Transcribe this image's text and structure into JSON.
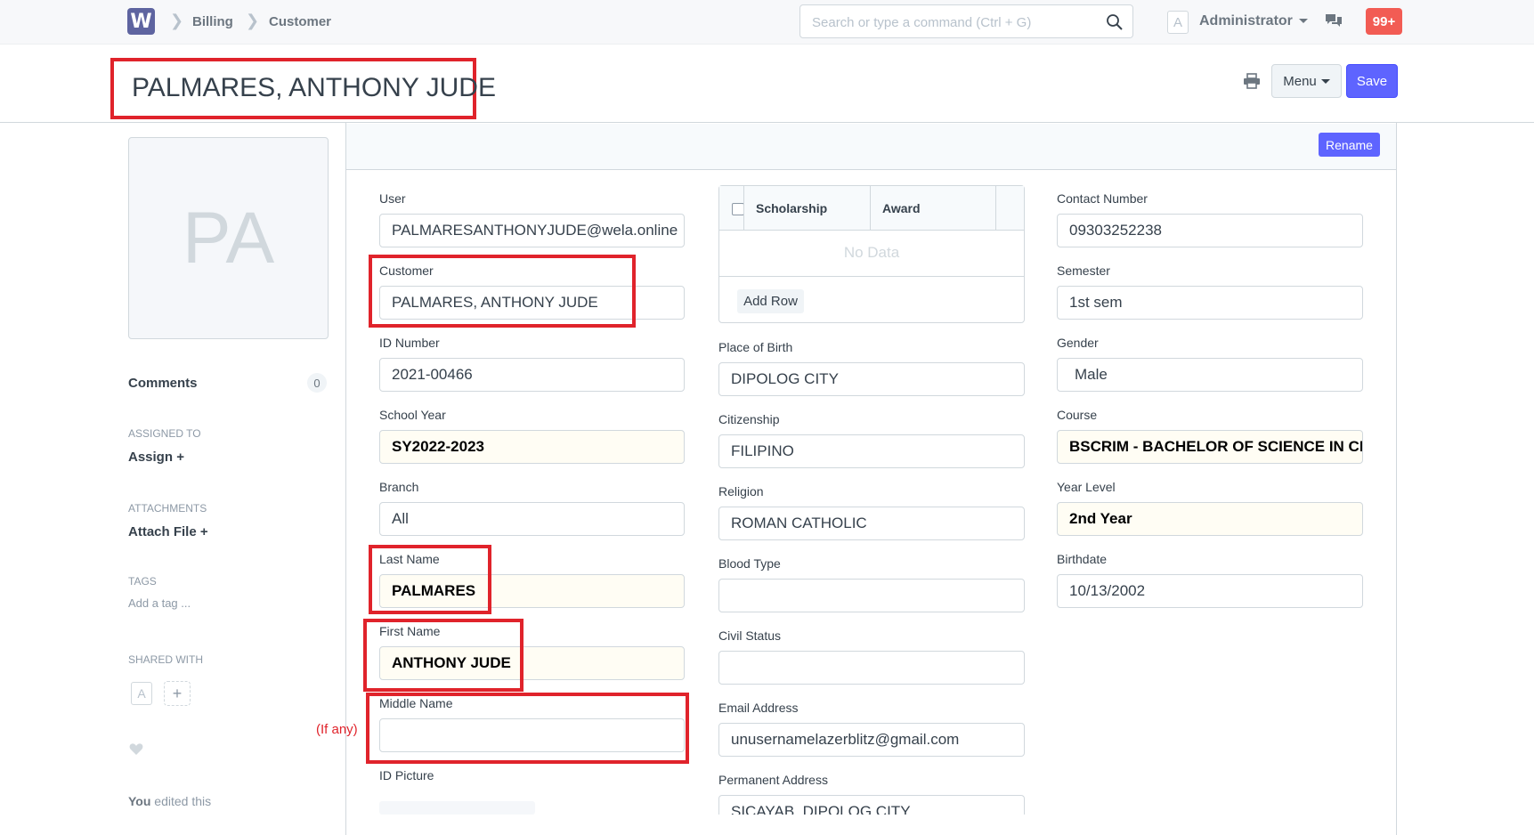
{
  "navbar": {
    "logo": "W",
    "breadcrumbs": [
      "Billing",
      "Customer"
    ],
    "search_placeholder": "Search or type a command (Ctrl + G)",
    "user_initial": "A",
    "user_name": "Administrator",
    "notification_count": "99+"
  },
  "page": {
    "title": "PALMARES, ANTHONY JUDE",
    "menu_label": "Menu",
    "save_label": "Save",
    "rename_label": "Rename"
  },
  "sidebar": {
    "avatar_initials": "PA",
    "comments_label": "Comments",
    "comments_count": "0",
    "assigned_to_label": "ASSIGNED TO",
    "assign_label": "Assign",
    "attachments_label": "ATTACHMENTS",
    "attach_file_label": "Attach File",
    "tags_label": "TAGS",
    "add_tag_label": "Add a tag ...",
    "shared_with_label": "SHARED WITH",
    "shared_initial": "A",
    "edited_by": "You",
    "edited_text": "edited this"
  },
  "form": {
    "user": {
      "label": "User",
      "value": "PALMARESANTHONYJUDE@wela.online"
    },
    "customer": {
      "label": "Customer",
      "value": "PALMARES, ANTHONY JUDE"
    },
    "id_number": {
      "label": "ID Number",
      "value": "2021-00466"
    },
    "school_year": {
      "label": "School Year",
      "value": "SY2022-2023"
    },
    "branch": {
      "label": "Branch",
      "value": "All"
    },
    "last_name": {
      "label": "Last Name",
      "value": "PALMARES"
    },
    "first_name": {
      "label": "First Name",
      "value": "ANTHONY JUDE"
    },
    "middle_name": {
      "label": "Middle Name",
      "value": "",
      "note": "(If any)"
    },
    "id_picture": {
      "label": "ID Picture"
    },
    "scholarship_table": {
      "columns": [
        "Scholarship",
        "Award"
      ],
      "empty_text": "No Data",
      "add_row_label": "Add Row"
    },
    "place_of_birth": {
      "label": "Place of Birth",
      "value": "DIPOLOG CITY"
    },
    "citizenship": {
      "label": "Citizenship",
      "value": "FILIPINO"
    },
    "religion": {
      "label": "Religion",
      "value": "ROMAN CATHOLIC"
    },
    "blood_type": {
      "label": "Blood Type",
      "value": ""
    },
    "civil_status": {
      "label": "Civil Status",
      "value": ""
    },
    "email_address": {
      "label": "Email Address",
      "value": "unusernamelazerblitz@gmail.com"
    },
    "permanent_address": {
      "label": "Permanent Address",
      "value": "SICAYAB, DIPOLOG CITY"
    },
    "contact_number": {
      "label": "Contact Number",
      "value": "09303252238"
    },
    "semester": {
      "label": "Semester",
      "value": "1st sem"
    },
    "gender": {
      "label": "Gender",
      "value": "Male"
    },
    "course": {
      "label": "Course",
      "value": "BSCRIM - BACHELOR OF SCIENCE IN CRIMINOLOGY"
    },
    "year_level": {
      "label": "Year Level",
      "value": "2nd Year"
    },
    "birthdate": {
      "label": "Birthdate",
      "value": "10/13/2002"
    }
  }
}
